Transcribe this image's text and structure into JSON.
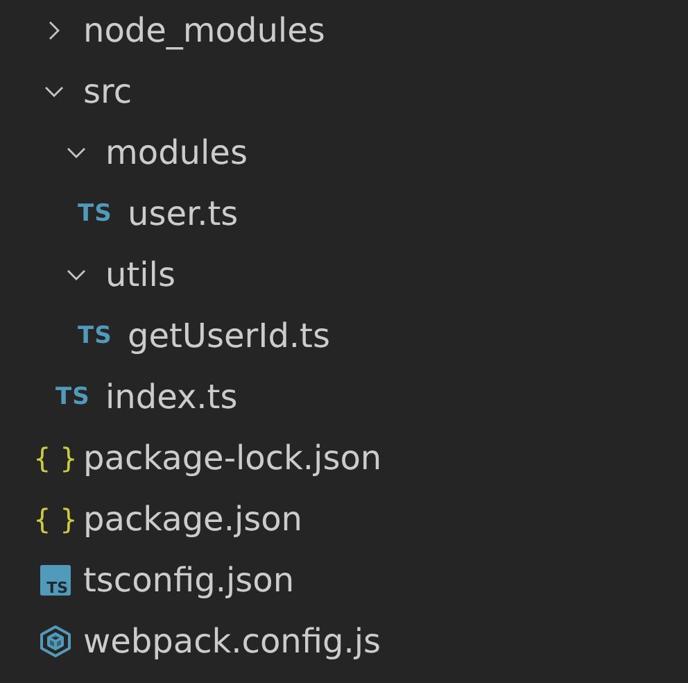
{
  "tree": [
    {
      "kind": "folder",
      "name": "node_modules",
      "expanded": false
    },
    {
      "kind": "folder",
      "name": "src",
      "expanded": true,
      "children": [
        {
          "kind": "folder",
          "name": "modules",
          "expanded": true,
          "children": [
            {
              "kind": "ts",
              "badge": "TS",
              "name": "user.ts"
            }
          ]
        },
        {
          "kind": "folder",
          "name": "utils",
          "expanded": true,
          "children": [
            {
              "kind": "ts",
              "badge": "TS",
              "name": "getUserId.ts"
            }
          ]
        },
        {
          "kind": "ts",
          "badge": "TS",
          "name": "index.ts"
        }
      ]
    },
    {
      "kind": "json",
      "badge": "{ }",
      "name": "package-lock.json"
    },
    {
      "kind": "json",
      "badge": "{ }",
      "name": "package.json"
    },
    {
      "kind": "tsconfig",
      "badge": "TS",
      "name": "tsconfig.json"
    },
    {
      "kind": "webpack",
      "name": "webpack.config.js"
    }
  ]
}
